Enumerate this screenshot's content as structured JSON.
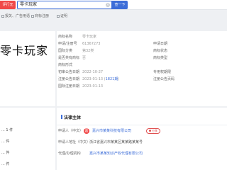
{
  "topbar": {
    "logo_label": "评行无",
    "search_value": "零卡玩家",
    "search_button": "查一下"
  },
  "subbar": {
    "item1": "报关、广告用语",
    "item2": "商标注册",
    "item3": "证明"
  },
  "brand": {
    "name": "零卡玩家"
  },
  "info": {
    "rows": [
      {
        "label": "商标名称",
        "value": "零卡玩家",
        "label2": "",
        "value2": ""
      },
      {
        "label": "申请/注册号",
        "value": "61367273",
        "label2": "申请日期",
        "value2": ""
      },
      {
        "label": "国际分类",
        "value": "第32类",
        "label2": "商标状态",
        "value2": ""
      },
      {
        "label": "是否共有商标",
        "value": "否",
        "label2": "商标类型",
        "value2": ""
      },
      {
        "label": "商标形式",
        "value": "",
        "label2": "",
        "value2": ""
      },
      {
        "label": "初审公告日期",
        "value": "2022-10-27",
        "label2": "专用权期限",
        "value2": ""
      },
      {
        "label": "注册公告日期",
        "value": "2023-01-13",
        "value_link": "1821期",
        "label2": "注册公告页码",
        "value2": ""
      },
      {
        "label": "国际注册日期",
        "value": "2023-01-13",
        "label2": "",
        "value2": ""
      }
    ]
  },
  "left_bottom": {
    "lines": [
      "... 1 件",
      "... 件",
      "... 件",
      "... 件"
    ]
  },
  "legal": {
    "title": "法律主体",
    "rows": [
      {
        "label": "申请人（中文）",
        "avatar": "嘉",
        "value": "嘉兴市某某科技有限公司",
        "tag": "",
        "share": "分享"
      },
      {
        "label": "申请人地址（中文）",
        "value": "浙江省嘉兴市某某区某某路某某号"
      },
      {
        "label": "代理/办理机构",
        "value": "嘉兴市某某知识产权代理有限公司"
      }
    ]
  },
  "colors": {
    "accent": "#3c6dd8",
    "brand_red": "#f04848"
  }
}
